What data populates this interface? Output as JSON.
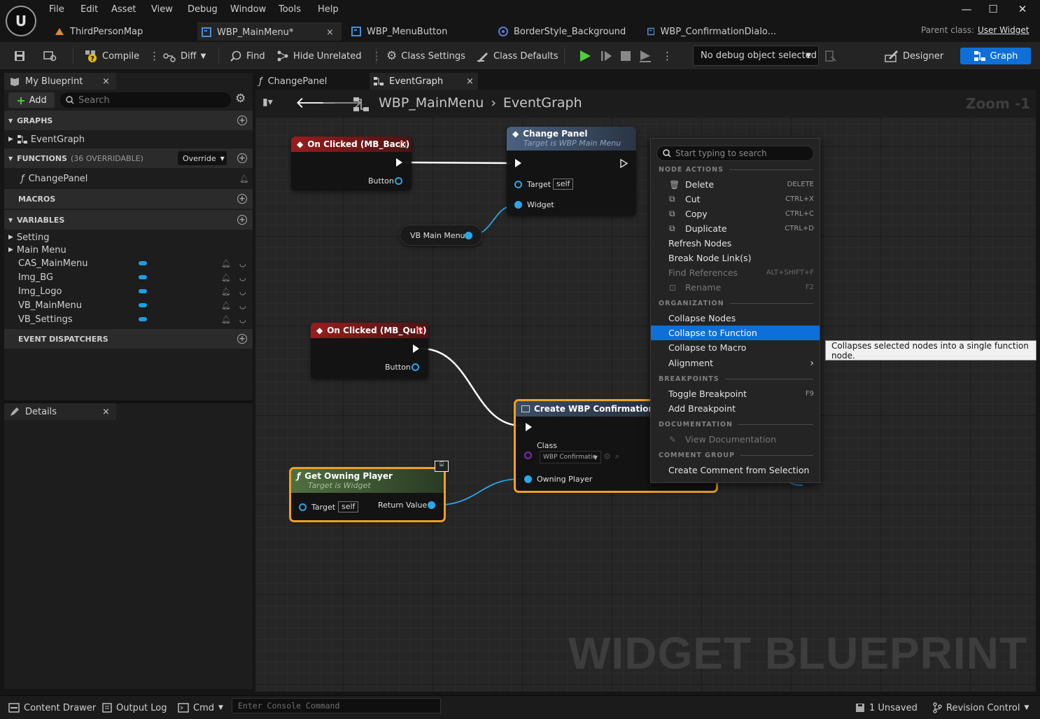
{
  "menu": [
    "File",
    "Edit",
    "Asset",
    "View",
    "Debug",
    "Window",
    "Tools",
    "Help"
  ],
  "doc_tabs": [
    {
      "label": "ThirdPersonMap"
    },
    {
      "label": "WBP_MainMenu*",
      "close": "×"
    },
    {
      "label": "WBP_MenuButton"
    },
    {
      "label": "BorderStyle_Background"
    },
    {
      "label": "WBP_ConfirmationDialo..."
    }
  ],
  "parent_class": {
    "label": "Parent class:",
    "value": "User Widget"
  },
  "toolbar": {
    "compile": "Compile",
    "diff": "Diff",
    "find": "Find",
    "hide_unrelated": "Hide Unrelated",
    "class_settings": "Class Settings",
    "class_defaults": "Class Defaults",
    "debug_select": "No debug object selected",
    "designer": "Designer",
    "graph": "Graph"
  },
  "my_blueprint": {
    "tab": "My Blueprint",
    "add": "Add",
    "search_placeholder": "Search",
    "graphs_header": "GRAPHS",
    "graphs": [
      "EventGraph"
    ],
    "functions_header": "FUNCTIONS",
    "functions_count": "(36 OVERRIDABLE)",
    "override": "Override",
    "functions": [
      "ChangePanel"
    ],
    "macros_header": "MACROS",
    "variables_header": "VARIABLES",
    "categories": [
      "Setting",
      "Main Menu"
    ],
    "variables": [
      "CAS_MainMenu",
      "Img_BG",
      "Img_Logo",
      "VB_MainMenu",
      "VB_Settings"
    ],
    "dispatchers_header": "EVENT DISPATCHERS"
  },
  "details": {
    "tab": "Details"
  },
  "graph_tabs": [
    {
      "label": "ChangePanel"
    },
    {
      "label": "EventGraph"
    }
  ],
  "breadcrumb": {
    "root": "WBP_MainMenu",
    "leaf": "EventGraph"
  },
  "zoom": "Zoom -1",
  "watermark": "WIDGET BLUEPRINT",
  "nodes": {
    "on_clicked_back": {
      "title": "On Clicked (MB_Back)",
      "pin": "Button"
    },
    "change_panel": {
      "title": "Change Panel",
      "subtitle": "Target is WBP Main Menu",
      "target": "Target",
      "self": "self",
      "widget": "Widget"
    },
    "vb_main_menu": {
      "title": "VB Main Menu"
    },
    "on_clicked_quit": {
      "title": "On Clicked (MB_Quit)",
      "pin": "Button"
    },
    "create_widget": {
      "title": "Create WBP Confirmation Dialo",
      "class_label": "Class",
      "class_value": "WBP Confirmatic",
      "owning": "Owning Player"
    },
    "get_owning_player": {
      "title": "Get Owning Player",
      "subtitle": "Target is Widget",
      "target": "Target",
      "self": "self",
      "return": "Return Value"
    }
  },
  "context_menu": {
    "search_placeholder": "Start typing to search",
    "sections": {
      "node_actions": "NODE ACTIONS",
      "organization": "ORGANIZATION",
      "breakpoints": "BREAKPOINTS",
      "documentation": "DOCUMENTATION",
      "comment_group": "COMMENT GROUP"
    },
    "items": {
      "delete": {
        "label": "Delete",
        "shortcut": "DELETE"
      },
      "cut": {
        "label": "Cut",
        "shortcut": "CTRL+X"
      },
      "copy": {
        "label": "Copy",
        "shortcut": "CTRL+C"
      },
      "duplicate": {
        "label": "Duplicate",
        "shortcut": "CTRL+D"
      },
      "refresh": {
        "label": "Refresh Nodes"
      },
      "break_links": {
        "label": "Break Node Link(s)"
      },
      "find_refs": {
        "label": "Find References",
        "shortcut": "ALT+SHIFT+F"
      },
      "rename": {
        "label": "Rename",
        "shortcut": "F2"
      },
      "collapse_nodes": {
        "label": "Collapse Nodes"
      },
      "collapse_function": {
        "label": "Collapse to Function"
      },
      "collapse_macro": {
        "label": "Collapse to Macro"
      },
      "alignment": {
        "label": "Alignment"
      },
      "toggle_bp": {
        "label": "Toggle Breakpoint",
        "shortcut": "F9"
      },
      "add_bp": {
        "label": "Add Breakpoint"
      },
      "view_docs": {
        "label": "View Documentation"
      },
      "create_comment": {
        "label": "Create Comment from Selection"
      }
    },
    "tooltip": "Collapses selected nodes into a single function node."
  },
  "statusbar": {
    "content_drawer": "Content Drawer",
    "output_log": "Output Log",
    "cmd": "Cmd",
    "console_placeholder": "Enter Console Command",
    "unsaved": "1 Unsaved",
    "revision_control": "Revision Control"
  },
  "colors": {
    "accent": "#0f6fd8",
    "event_head": "#8a1a1a",
    "func_head": "#3b4d63",
    "pure_head": "#4c6a3c",
    "selection": "#f0a020",
    "pin": "#2aa7ea"
  }
}
